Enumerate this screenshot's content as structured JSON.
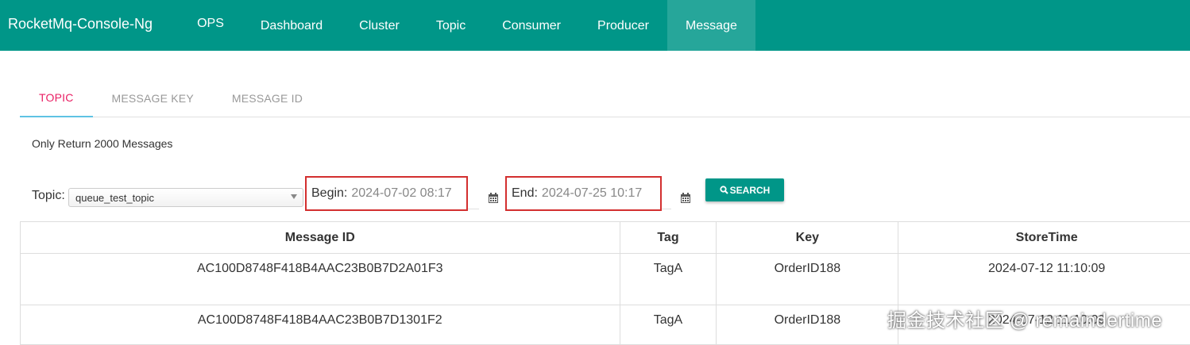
{
  "app": {
    "brand": "RocketMq-Console-Ng"
  },
  "nav": {
    "items": [
      {
        "label": "OPS"
      },
      {
        "label": "Dashboard"
      },
      {
        "label": "Cluster"
      },
      {
        "label": "Topic"
      },
      {
        "label": "Consumer"
      },
      {
        "label": "Producer"
      },
      {
        "label": "Message",
        "active": true
      }
    ]
  },
  "tabs": [
    {
      "label": "TOPIC",
      "active": true
    },
    {
      "label": "MESSAGE KEY"
    },
    {
      "label": "MESSAGE ID"
    }
  ],
  "notice": "Only Return 2000 Messages",
  "filter": {
    "topic_label": "Topic:",
    "topic_value": "queue_test_topic",
    "begin_label": "Begin:",
    "begin_value": "2024-07-02 08:17",
    "end_label": "End:",
    "end_value": "2024-07-25 10:17",
    "search_label": "SEARCH"
  },
  "table": {
    "headers": [
      "Message ID",
      "Tag",
      "Key",
      "StoreTime"
    ],
    "rows": [
      [
        "AC100D8748F418B4AAC23B0B7D2A01F3",
        "TagA",
        "OrderID188",
        "2024-07-12 11:10:09"
      ],
      [
        "AC100D8748F418B4AAC23B0B7D1301F2",
        "TagA",
        "OrderID188",
        "2024-07-12 11:10:09"
      ]
    ]
  },
  "watermark": "掘金技术社区 @ remaindertime",
  "colors": {
    "primary": "#009688",
    "active_nav": "#26a69a",
    "active_tab_text": "#e91e63",
    "highlight_box": "#d32f2f"
  }
}
